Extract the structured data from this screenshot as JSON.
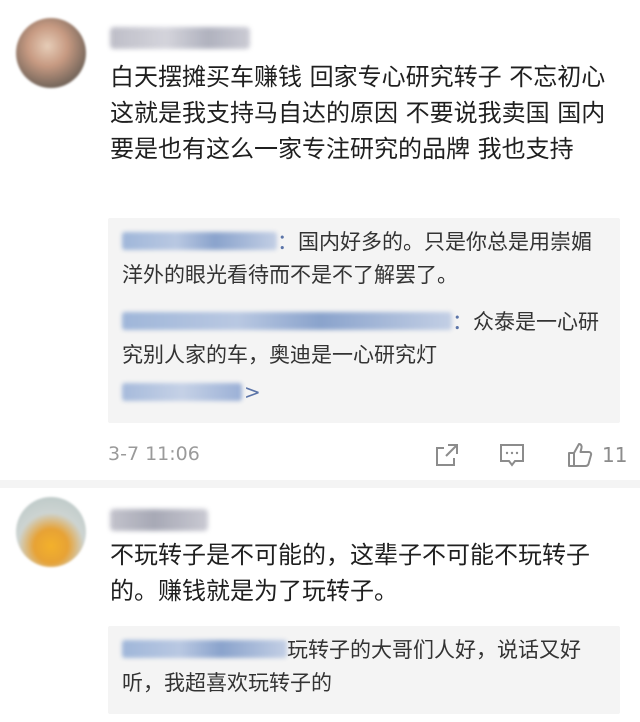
{
  "comments": [
    {
      "username": "",
      "text": "白天摆摊买车赚钱 回家专心研究转子 不忘初心 这就是我支持马自达的原因 不要说我卖国 国内要是也有这么一家专注研究的品牌 我也支持",
      "replies": [
        {
          "name_suffix": "：",
          "text": "国内好多的。只是你总是用崇媚洋外的眼光看待而不是不了解罢了。"
        },
        {
          "name_suffix": "：",
          "text": "众泰是一心研究别人家的车，奥迪是一心研究灯"
        }
      ],
      "more_replies_chevron": ">",
      "timestamp": "3-7 11:06",
      "icons": {
        "share": "share-icon",
        "reply": "comment-icon",
        "like": "thumbs-up-icon"
      },
      "like_count": "11"
    },
    {
      "username": "",
      "text": "不玩转子是不可能的，这辈子不可能不玩转子的。赚钱就是为了玩转子。",
      "replies": [
        {
          "name_suffix": "",
          "text": "玩转子的大哥们人好，说话又好听，我超喜欢玩转子的"
        }
      ]
    }
  ],
  "colors": {
    "link_blue": "#5b74a8",
    "meta_gray": "#9a9a9a",
    "reply_bg": "#f4f4f4"
  }
}
